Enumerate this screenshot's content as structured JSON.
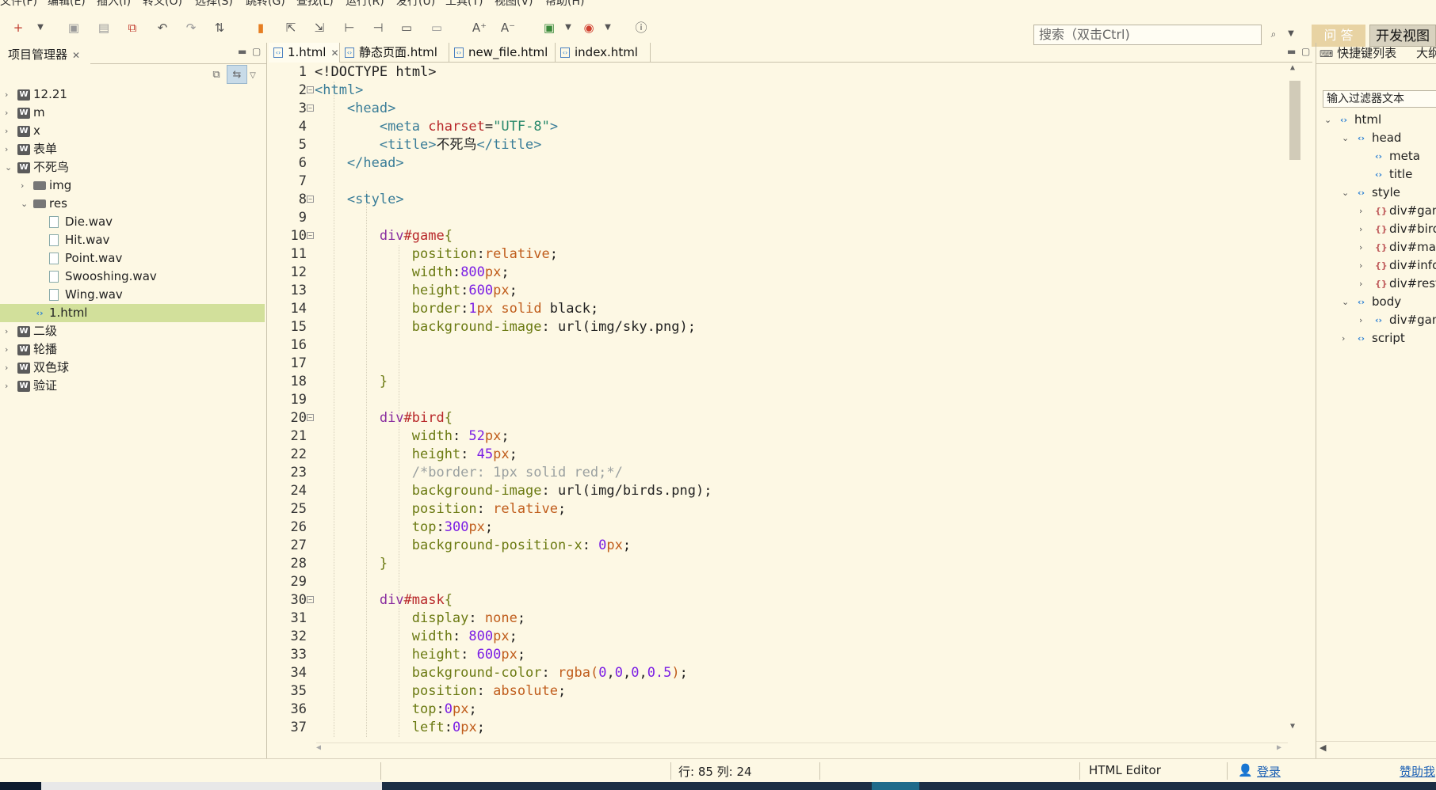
{
  "menu": [
    "文件(F)",
    "编辑(E)",
    "插入(I)",
    "转义(O)",
    "选择(S)",
    "跳转(G)",
    "查找(L)",
    "运行(R)",
    "发行(U)",
    "工具(T)",
    "视图(V)",
    "帮助(H)"
  ],
  "search": {
    "placeholder": "搜索（双击Ctrl)"
  },
  "toolbar": {
    "ask_label": "问 答",
    "dev_view_label": "开发视图"
  },
  "project_panel": {
    "title": "项目管理器"
  },
  "project_tree": [
    {
      "label": "12.21",
      "type": "project",
      "state": "collapsed",
      "depth": 0
    },
    {
      "label": "m",
      "type": "project",
      "state": "collapsed",
      "depth": 0
    },
    {
      "label": "x",
      "type": "project",
      "state": "collapsed",
      "depth": 0
    },
    {
      "label": "表单",
      "type": "project",
      "state": "collapsed",
      "depth": 0
    },
    {
      "label": "不死鸟",
      "type": "project",
      "state": "expanded",
      "depth": 0
    },
    {
      "label": "img",
      "type": "folder",
      "state": "collapsed",
      "depth": 1
    },
    {
      "label": "res",
      "type": "folder",
      "state": "expanded",
      "depth": 1
    },
    {
      "label": "Die.wav",
      "type": "file",
      "state": "",
      "depth": 2
    },
    {
      "label": "Hit.wav",
      "type": "file",
      "state": "",
      "depth": 2
    },
    {
      "label": "Point.wav",
      "type": "file",
      "state": "",
      "depth": 2
    },
    {
      "label": "Swooshing.wav",
      "type": "file",
      "state": "",
      "depth": 2
    },
    {
      "label": "Wing.wav",
      "type": "file",
      "state": "",
      "depth": 2
    },
    {
      "label": "1.html",
      "type": "html",
      "state": "",
      "depth": 1,
      "selected": true
    },
    {
      "label": "二级",
      "type": "project",
      "state": "collapsed",
      "depth": 0
    },
    {
      "label": "轮播",
      "type": "project",
      "state": "collapsed",
      "depth": 0
    },
    {
      "label": "双色球",
      "type": "project",
      "state": "collapsed",
      "depth": 0
    },
    {
      "label": "验证",
      "type": "project",
      "state": "collapsed",
      "depth": 0
    }
  ],
  "editor_tabs": [
    {
      "label": "1.html",
      "active": true,
      "closable": true
    },
    {
      "label": "静态页面.html",
      "active": false
    },
    {
      "label": "new_file.html",
      "active": false
    },
    {
      "label": "index.html",
      "active": false
    }
  ],
  "code_lines": [
    {
      "n": 1,
      "indent": 0,
      "fold": false,
      "tokens": [
        [
          "plain",
          "<!DOCTYPE html>"
        ]
      ]
    },
    {
      "n": 2,
      "indent": 0,
      "fold": true,
      "tokens": [
        [
          "tag",
          "<html>"
        ]
      ]
    },
    {
      "n": 3,
      "indent": 1,
      "fold": true,
      "tokens": [
        [
          "tag",
          "<head>"
        ]
      ]
    },
    {
      "n": 4,
      "indent": 2,
      "fold": false,
      "tokens": [
        [
          "tag",
          "<meta "
        ],
        [
          "attr",
          "charset"
        ],
        [
          "plain",
          "="
        ],
        [
          "str",
          "\"UTF-8\""
        ],
        [
          "tag",
          ">"
        ]
      ]
    },
    {
      "n": 5,
      "indent": 2,
      "fold": false,
      "tokens": [
        [
          "tag",
          "<title>"
        ],
        [
          "plain",
          "不死鸟"
        ],
        [
          "tag",
          "</title>"
        ]
      ]
    },
    {
      "n": 6,
      "indent": 1,
      "fold": false,
      "tokens": [
        [
          "tag",
          "</head>"
        ]
      ]
    },
    {
      "n": 7,
      "indent": 0,
      "fold": false,
      "tokens": []
    },
    {
      "n": 8,
      "indent": 1,
      "fold": true,
      "tokens": [
        [
          "tag",
          "<style>"
        ]
      ]
    },
    {
      "n": 9,
      "indent": 0,
      "fold": false,
      "tokens": []
    },
    {
      "n": 10,
      "indent": 2,
      "fold": true,
      "tokens": [
        [
          "sel-tag",
          "div"
        ],
        [
          "sel-name",
          "#game"
        ],
        [
          "brace",
          "{"
        ]
      ]
    },
    {
      "n": 11,
      "indent": 3,
      "fold": false,
      "tokens": [
        [
          "prop",
          "position"
        ],
        [
          "plain",
          ":"
        ],
        [
          "val",
          "relative"
        ],
        [
          "plain",
          ";"
        ]
      ]
    },
    {
      "n": 12,
      "indent": 3,
      "fold": false,
      "tokens": [
        [
          "prop",
          "width"
        ],
        [
          "plain",
          ":"
        ],
        [
          "num",
          "800"
        ],
        [
          "val",
          "px"
        ],
        [
          "plain",
          ";"
        ]
      ]
    },
    {
      "n": 13,
      "indent": 3,
      "fold": false,
      "tokens": [
        [
          "prop",
          "height"
        ],
        [
          "plain",
          ":"
        ],
        [
          "num",
          "600"
        ],
        [
          "val",
          "px"
        ],
        [
          "plain",
          ";"
        ]
      ]
    },
    {
      "n": 14,
      "indent": 3,
      "fold": false,
      "tokens": [
        [
          "prop",
          "border"
        ],
        [
          "plain",
          ":"
        ],
        [
          "num",
          "1"
        ],
        [
          "val",
          "px solid "
        ],
        [
          "plain",
          "black;"
        ]
      ]
    },
    {
      "n": 15,
      "indent": 3,
      "fold": false,
      "tokens": [
        [
          "prop",
          "background-image"
        ],
        [
          "plain",
          ": url(img/sky.png);"
        ]
      ]
    },
    {
      "n": 16,
      "indent": 0,
      "fold": false,
      "tokens": []
    },
    {
      "n": 17,
      "indent": 0,
      "fold": false,
      "tokens": []
    },
    {
      "n": 18,
      "indent": 2,
      "fold": false,
      "tokens": [
        [
          "brace",
          "}"
        ]
      ]
    },
    {
      "n": 19,
      "indent": 0,
      "fold": false,
      "tokens": []
    },
    {
      "n": 20,
      "indent": 2,
      "fold": true,
      "tokens": [
        [
          "sel-tag",
          "div"
        ],
        [
          "sel-name",
          "#bird"
        ],
        [
          "brace",
          "{"
        ]
      ]
    },
    {
      "n": 21,
      "indent": 3,
      "fold": false,
      "tokens": [
        [
          "prop",
          "width"
        ],
        [
          "plain",
          ": "
        ],
        [
          "num",
          "52"
        ],
        [
          "val",
          "px"
        ],
        [
          "plain",
          ";"
        ]
      ]
    },
    {
      "n": 22,
      "indent": 3,
      "fold": false,
      "tokens": [
        [
          "prop",
          "height"
        ],
        [
          "plain",
          ": "
        ],
        [
          "num",
          "45"
        ],
        [
          "val",
          "px"
        ],
        [
          "plain",
          ";"
        ]
      ]
    },
    {
      "n": 23,
      "indent": 3,
      "fold": false,
      "tokens": [
        [
          "comment",
          "/*border: 1px solid red;*/"
        ]
      ]
    },
    {
      "n": 24,
      "indent": 3,
      "fold": false,
      "tokens": [
        [
          "prop",
          "background-image"
        ],
        [
          "plain",
          ": url(img/birds.png);"
        ]
      ]
    },
    {
      "n": 25,
      "indent": 3,
      "fold": false,
      "tokens": [
        [
          "prop",
          "position"
        ],
        [
          "plain",
          ": "
        ],
        [
          "val",
          "relative"
        ],
        [
          "plain",
          ";"
        ]
      ]
    },
    {
      "n": 26,
      "indent": 3,
      "fold": false,
      "tokens": [
        [
          "prop",
          "top"
        ],
        [
          "plain",
          ":"
        ],
        [
          "num",
          "300"
        ],
        [
          "val",
          "px"
        ],
        [
          "plain",
          ";"
        ]
      ]
    },
    {
      "n": 27,
      "indent": 3,
      "fold": false,
      "tokens": [
        [
          "prop",
          "background-position-x"
        ],
        [
          "plain",
          ": "
        ],
        [
          "num",
          "0"
        ],
        [
          "val",
          "px"
        ],
        [
          "plain",
          ";"
        ]
      ]
    },
    {
      "n": 28,
      "indent": 2,
      "fold": false,
      "tokens": [
        [
          "brace",
          "}"
        ]
      ]
    },
    {
      "n": 29,
      "indent": 0,
      "fold": false,
      "tokens": []
    },
    {
      "n": 30,
      "indent": 2,
      "fold": true,
      "tokens": [
        [
          "sel-tag",
          "div"
        ],
        [
          "sel-name",
          "#mask"
        ],
        [
          "brace",
          "{"
        ]
      ]
    },
    {
      "n": 31,
      "indent": 3,
      "fold": false,
      "tokens": [
        [
          "prop",
          "display"
        ],
        [
          "plain",
          ": "
        ],
        [
          "val",
          "none"
        ],
        [
          "plain",
          ";"
        ]
      ]
    },
    {
      "n": 32,
      "indent": 3,
      "fold": false,
      "tokens": [
        [
          "prop",
          "width"
        ],
        [
          "plain",
          ": "
        ],
        [
          "num",
          "800"
        ],
        [
          "val",
          "px"
        ],
        [
          "plain",
          ";"
        ]
      ]
    },
    {
      "n": 33,
      "indent": 3,
      "fold": false,
      "tokens": [
        [
          "prop",
          "height"
        ],
        [
          "plain",
          ": "
        ],
        [
          "num",
          "600"
        ],
        [
          "val",
          "px"
        ],
        [
          "plain",
          ";"
        ]
      ]
    },
    {
      "n": 34,
      "indent": 3,
      "fold": false,
      "tokens": [
        [
          "prop",
          "background-color"
        ],
        [
          "plain",
          ": "
        ],
        [
          "val",
          "rgba("
        ],
        [
          "num",
          "0"
        ],
        [
          "plain",
          ","
        ],
        [
          "num",
          "0"
        ],
        [
          "plain",
          ","
        ],
        [
          "num",
          "0"
        ],
        [
          "plain",
          ","
        ],
        [
          "num",
          "0.5"
        ],
        [
          "val",
          ")"
        ],
        [
          "plain",
          ";"
        ]
      ]
    },
    {
      "n": 35,
      "indent": 3,
      "fold": false,
      "tokens": [
        [
          "prop",
          "position"
        ],
        [
          "plain",
          ": "
        ],
        [
          "val",
          "absolute"
        ],
        [
          "plain",
          ";"
        ]
      ]
    },
    {
      "n": 36,
      "indent": 3,
      "fold": false,
      "tokens": [
        [
          "prop",
          "top"
        ],
        [
          "plain",
          ":"
        ],
        [
          "num",
          "0"
        ],
        [
          "val",
          "px"
        ],
        [
          "plain",
          ";"
        ]
      ]
    },
    {
      "n": 37,
      "indent": 3,
      "fold": false,
      "tokens": [
        [
          "prop",
          "left"
        ],
        [
          "plain",
          ":"
        ],
        [
          "num",
          "0"
        ],
        [
          "val",
          "px"
        ],
        [
          "plain",
          ";"
        ]
      ]
    }
  ],
  "right_panel": {
    "tab_shortcuts": "快捷键列表",
    "tab_outline": "大纲",
    "filter_placeholder": "输入过滤器文本"
  },
  "outline": [
    {
      "label": "html",
      "type": "el",
      "state": "expanded",
      "depth": 0
    },
    {
      "label": "head",
      "type": "el",
      "state": "expanded",
      "depth": 1
    },
    {
      "label": "meta",
      "type": "el",
      "state": "",
      "depth": 2
    },
    {
      "label": "title",
      "type": "el",
      "state": "",
      "depth": 2
    },
    {
      "label": "style",
      "type": "el",
      "state": "expanded",
      "depth": 1
    },
    {
      "label": "div#game",
      "type": "rule",
      "state": "collapsed",
      "depth": 2
    },
    {
      "label": "div#bird",
      "type": "rule",
      "state": "collapsed",
      "depth": 2
    },
    {
      "label": "div#mask",
      "type": "rule",
      "state": "collapsed",
      "depth": 2
    },
    {
      "label": "div#info",
      "type": "rule",
      "state": "collapsed",
      "depth": 2
    },
    {
      "label": "div#restart",
      "type": "rule",
      "state": "collapsed",
      "depth": 2
    },
    {
      "label": "body",
      "type": "el",
      "state": "expanded",
      "depth": 1
    },
    {
      "label": "div#game",
      "type": "el",
      "state": "collapsed",
      "depth": 2
    },
    {
      "label": "script",
      "type": "el",
      "state": "collapsed",
      "depth": 1
    }
  ],
  "status": {
    "position": "行: 85 列: 24",
    "editor_type": "HTML Editor",
    "login": "登录",
    "sponsor": "赞助我"
  }
}
